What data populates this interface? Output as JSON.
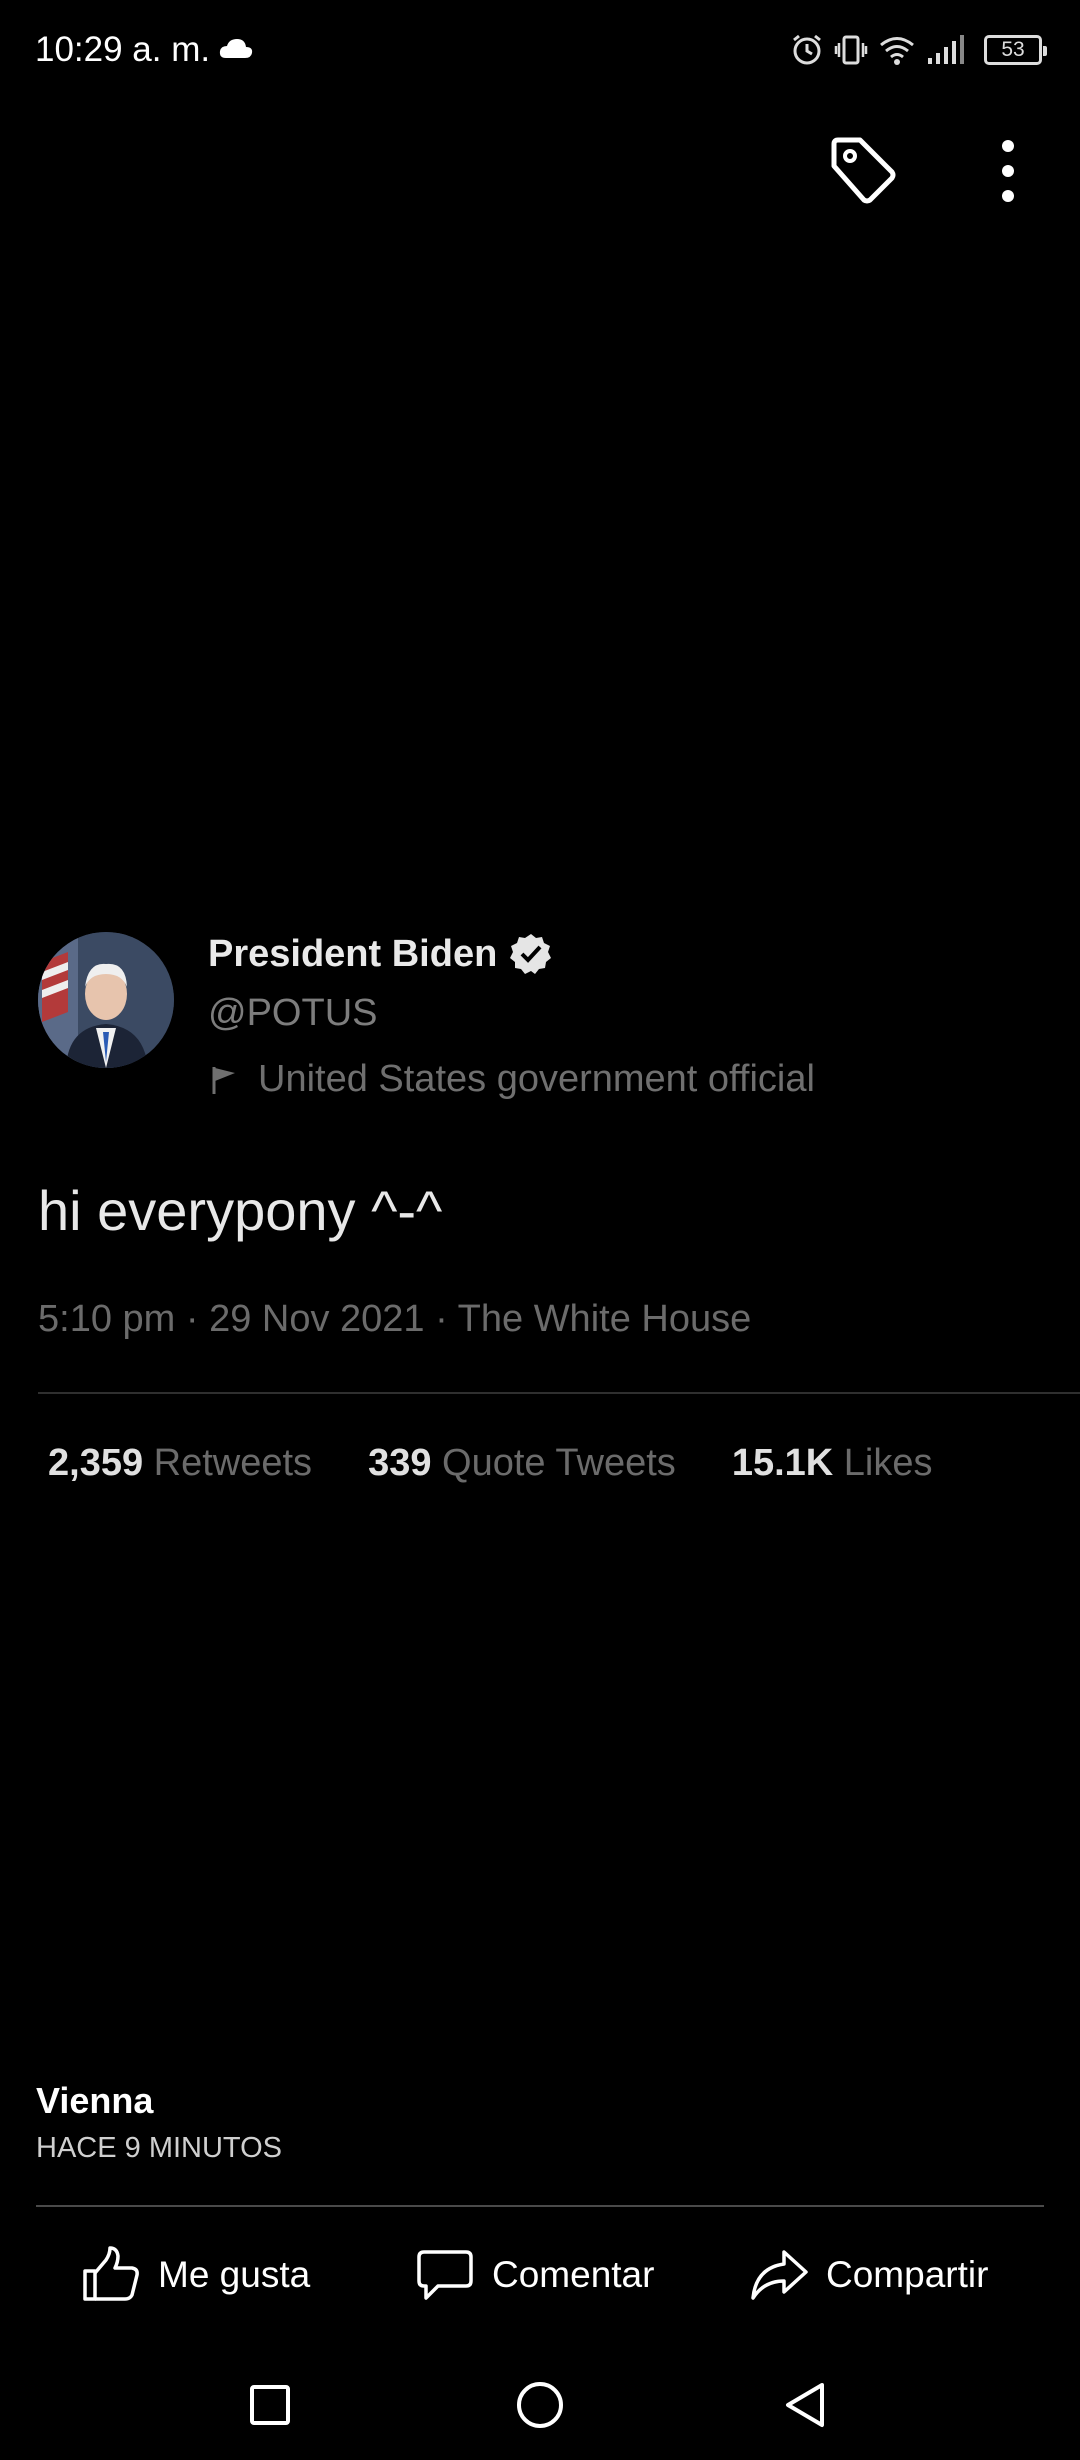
{
  "status_bar": {
    "time": "10:29 a. m.",
    "battery": "53",
    "icons": [
      "cloud-icon",
      "alarm-icon",
      "vibrate-icon",
      "wifi-icon",
      "signal-icon",
      "battery-icon"
    ]
  },
  "top_actions": {
    "icons": [
      "tag-icon",
      "more-vert-icon"
    ]
  },
  "tweet": {
    "name": "President Biden",
    "handle": "@POTUS",
    "label": "United States government official",
    "text": "hi everypony ^-^",
    "meta": "5:10 pm · 29 Nov 2021 · The White House",
    "stats": [
      {
        "number": "2,359",
        "label": "Retweets"
      },
      {
        "number": "339",
        "label": "Quote Tweets"
      },
      {
        "number": "15.1K",
        "label": "Likes"
      }
    ]
  },
  "post": {
    "author": "Vienna",
    "time": "HACE 9 MINUTOS"
  },
  "actions": {
    "like": "Me gusta",
    "comment": "Comentar",
    "share": "Compartir"
  },
  "colors": {
    "background": "#000000",
    "text_primary": "#ffffff",
    "text_muted": "#6b6b6b"
  }
}
